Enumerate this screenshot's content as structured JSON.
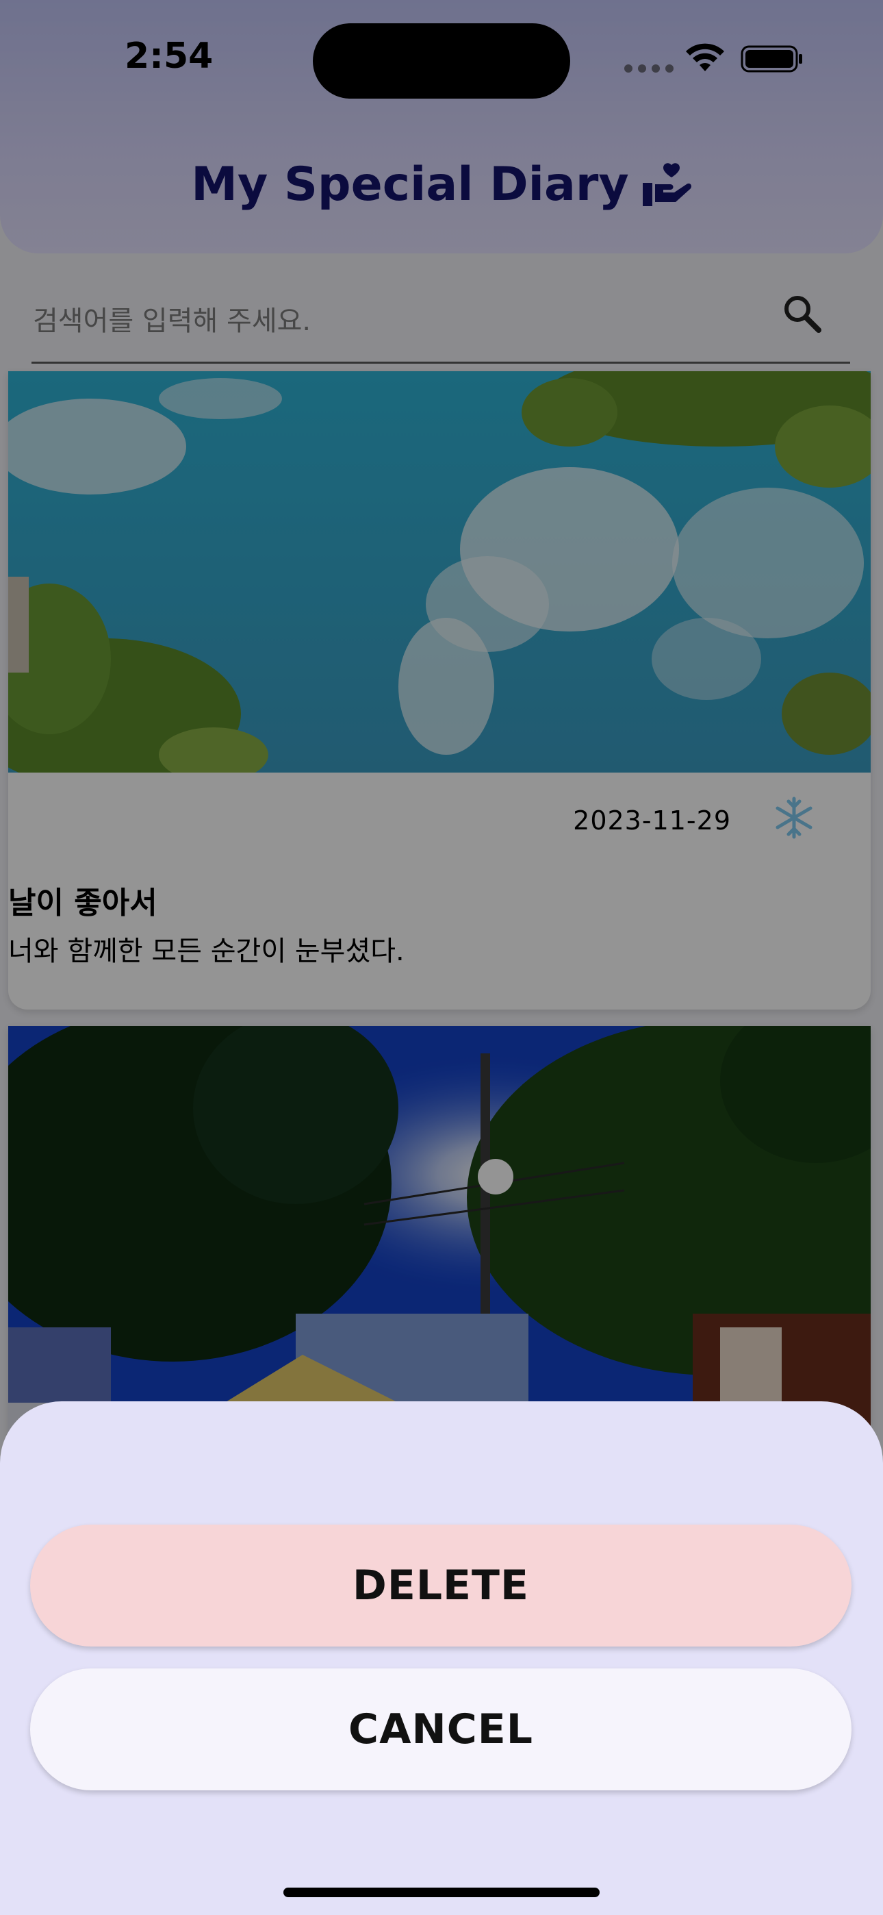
{
  "status_bar": {
    "time": "2:54"
  },
  "header": {
    "title": "My Special Diary",
    "title_icon": "hand-holding-heart-icon",
    "accent_color": "#13136b"
  },
  "search": {
    "placeholder": "검색어를 입력해 주세요.",
    "icon": "search-icon"
  },
  "diary_entries": [
    {
      "photo": "blue sky with clouds and tree branches",
      "date": "2023-11-29",
      "weather_icon": "snowflake-icon",
      "title": "날이 좋아서",
      "text": "너와 함께한 모든 순간이 눈부셨다."
    },
    {
      "photo": "night street with trees and a street lamp",
      "date": "",
      "title": "",
      "text": ""
    }
  ],
  "action_sheet": {
    "delete_label": "DELETE",
    "cancel_label": "CANCEL",
    "delete_color": "#f7d5d7",
    "cancel_color": "#f6f4fc",
    "sheet_color": "#e3e1f8"
  }
}
